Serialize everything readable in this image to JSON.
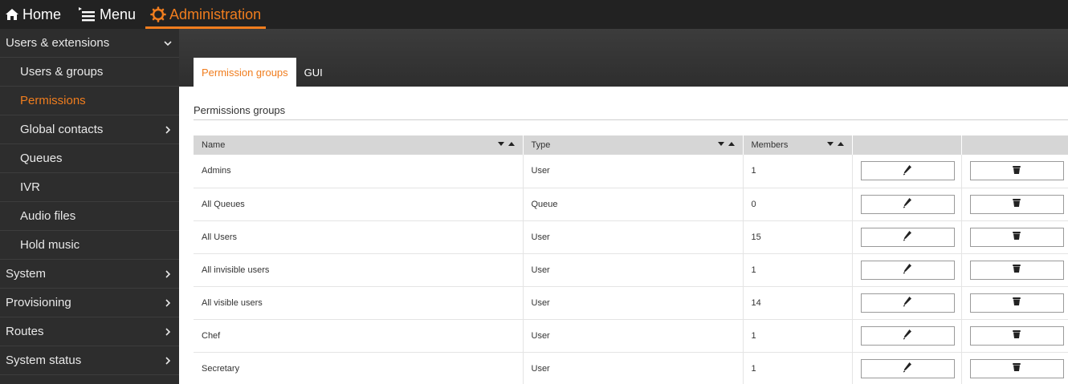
{
  "topbar": {
    "home_label": "Home",
    "menu_label": "Menu",
    "admin_label": "Administration",
    "accent_color": "#f07d1e"
  },
  "sidebar": {
    "items": [
      {
        "label": "Users & extensions",
        "level": 0,
        "chevron": "chevron-down-icon"
      },
      {
        "label": "Users & groups",
        "level": 1
      },
      {
        "label": "Permissions",
        "level": 1,
        "active": true
      },
      {
        "label": "Global contacts",
        "level": 1,
        "chevron": "chevron-right-icon"
      },
      {
        "label": "Queues",
        "level": 1
      },
      {
        "label": "IVR",
        "level": 1
      },
      {
        "label": "Audio files",
        "level": 1
      },
      {
        "label": "Hold music",
        "level": 1
      },
      {
        "label": "System",
        "level": 0,
        "chevron": "chevron-right-icon"
      },
      {
        "label": "Provisioning",
        "level": 0,
        "chevron": "chevron-right-icon"
      },
      {
        "label": "Routes",
        "level": 0,
        "chevron": "chevron-right-icon"
      },
      {
        "label": "System status",
        "level": 0,
        "chevron": "chevron-right-icon"
      }
    ]
  },
  "tabs": {
    "permission_groups": "Permission groups",
    "gui": "GUI"
  },
  "section_title": "Permissions groups",
  "table": {
    "headers": {
      "name": "Name",
      "type": "Type",
      "members": "Members"
    },
    "rows": [
      {
        "name": "Admins",
        "type": "User",
        "members": "1"
      },
      {
        "name": "All Queues",
        "type": "Queue",
        "members": "0"
      },
      {
        "name": "All Users",
        "type": "User",
        "members": "15"
      },
      {
        "name": "All invisible users",
        "type": "User",
        "members": "1"
      },
      {
        "name": "All visible users",
        "type": "User",
        "members": "14"
      },
      {
        "name": "Chef",
        "type": "User",
        "members": "1"
      },
      {
        "name": "Secretary",
        "type": "User",
        "members": "1"
      }
    ]
  }
}
